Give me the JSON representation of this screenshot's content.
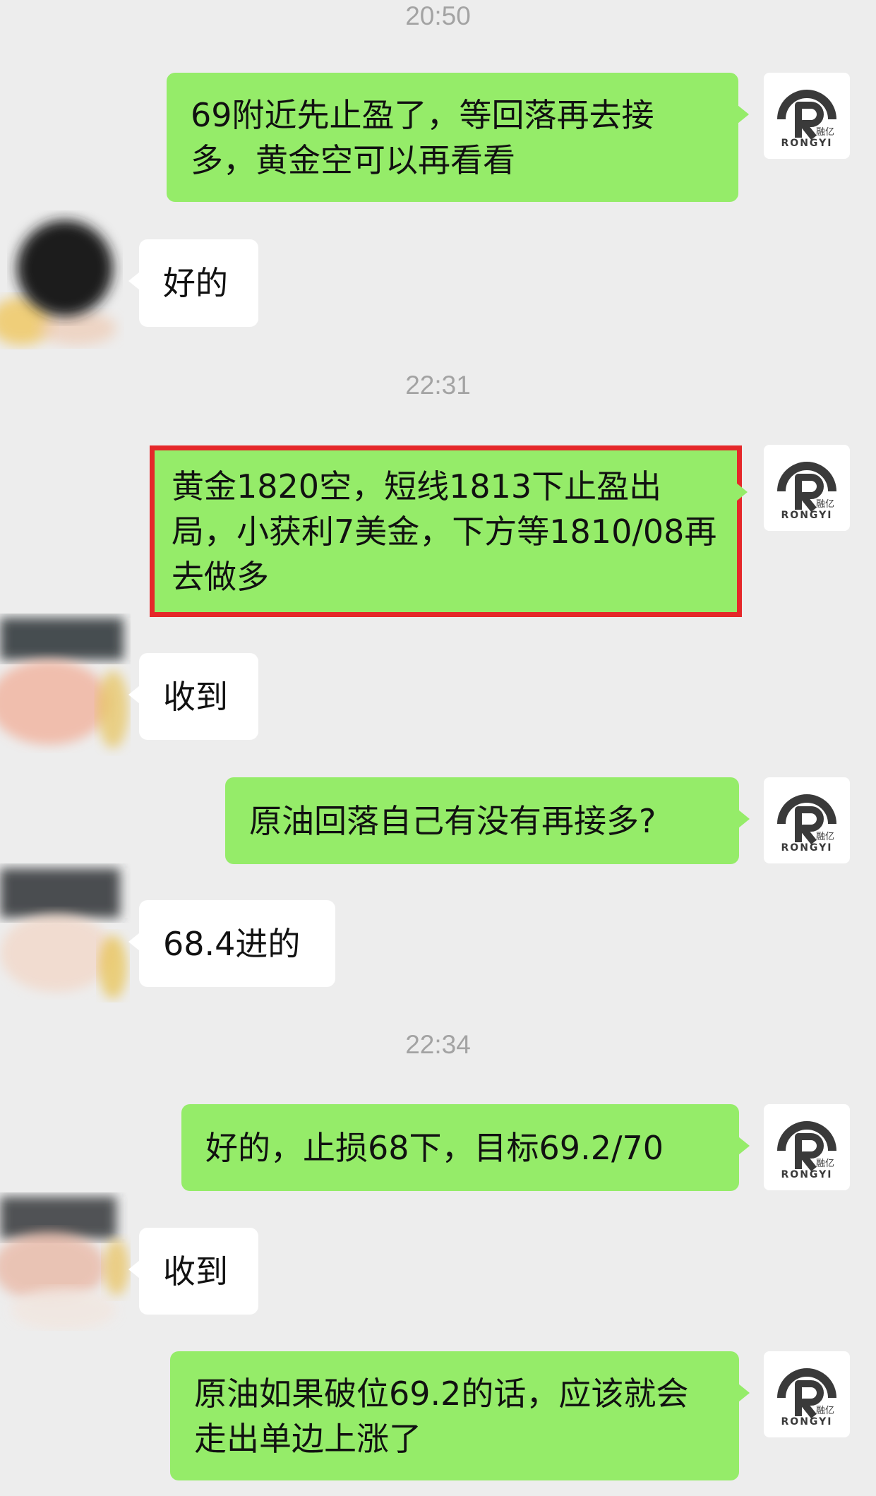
{
  "conversation": {
    "messages": [
      {
        "kind": "timestamp",
        "text": "20:50"
      },
      {
        "kind": "sent",
        "text": "69附近先止盈了，等回落再去接多，黄金空可以再看看"
      },
      {
        "kind": "received",
        "text": "好的"
      },
      {
        "kind": "timestamp",
        "text": "22:31"
      },
      {
        "kind": "sent",
        "text": "黄金1820空，短线1813下止盈出局，小获利7美金，下方等1810/08再去做多",
        "highlighted": true
      },
      {
        "kind": "received",
        "text": "收到"
      },
      {
        "kind": "sent",
        "text": "原油回落自己有没有再接多?"
      },
      {
        "kind": "received",
        "text": "68.4进的"
      },
      {
        "kind": "timestamp",
        "text": "22:34"
      },
      {
        "kind": "sent",
        "text": "好的，止损68下，目标69.2/70"
      },
      {
        "kind": "received",
        "text": "收到"
      },
      {
        "kind": "sent",
        "text": "原油如果破位69.2的话，应该就会走出单边上涨了"
      }
    ]
  },
  "contact": {
    "logo_text": "RONGYI",
    "logo_cn": "融亿",
    "logo_color": "#3a3a3a"
  },
  "colors": {
    "background": "#ededed",
    "sent_bubble": "#95ec69",
    "received_bubble": "#ffffff",
    "highlight_border": "#e5282a",
    "timestamp": "#a3a3a3"
  }
}
